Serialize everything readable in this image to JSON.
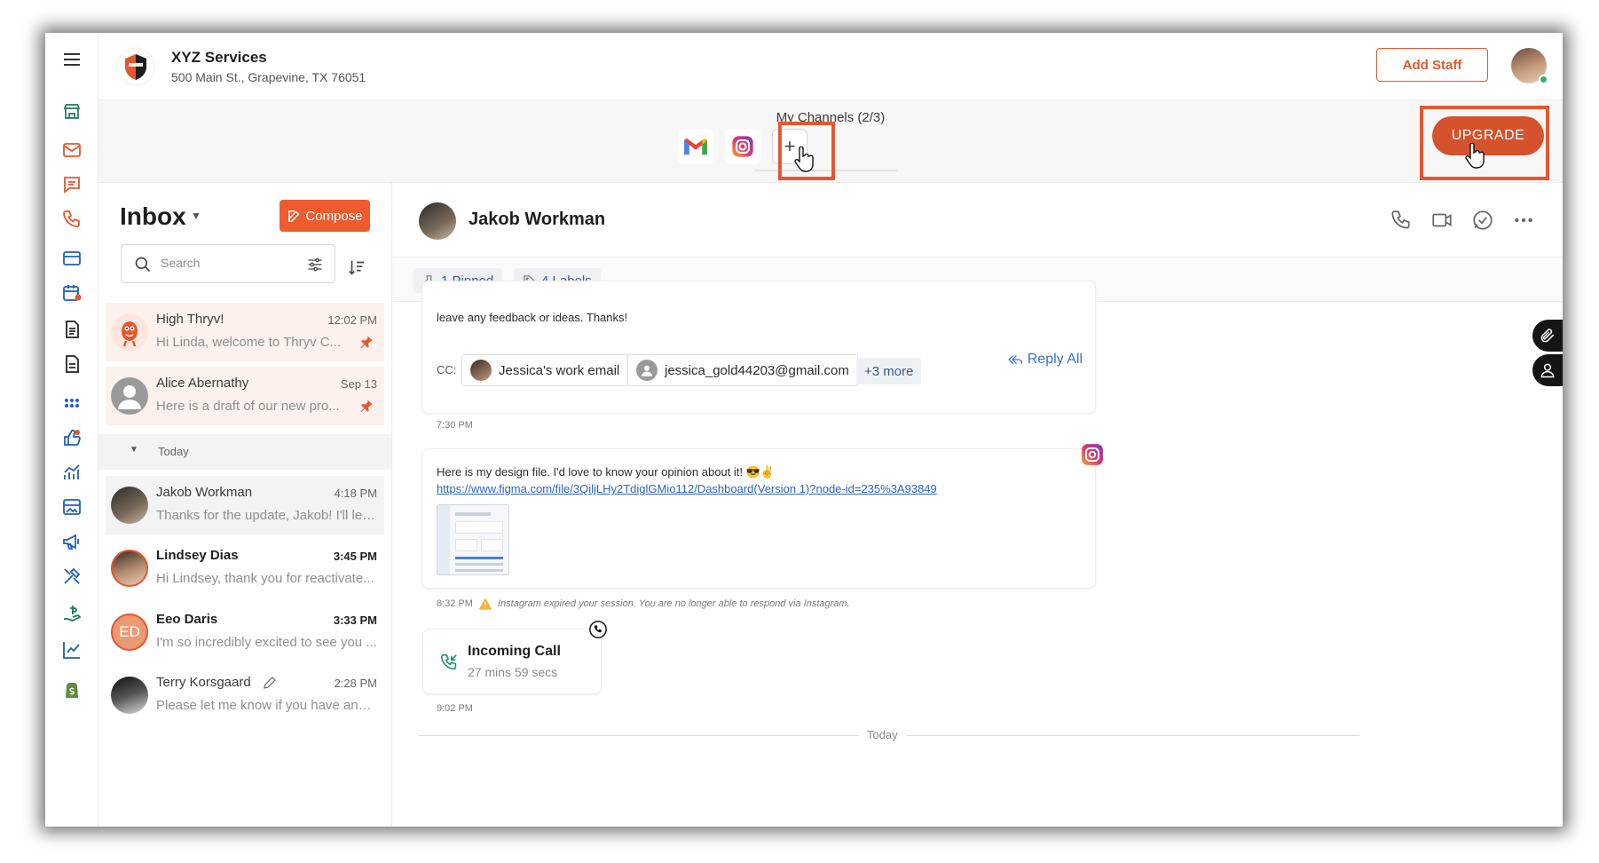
{
  "business": {
    "name": "XYZ Services",
    "address": "500 Main St., Grapevine, TX 76051"
  },
  "header": {
    "add_staff_label": "Add Staff"
  },
  "channels": {
    "title": "My Channels (2/3)",
    "items": [
      "gmail-icon",
      "instagram-icon"
    ],
    "add_label": "+",
    "upgrade_label": "UPGRADE"
  },
  "rail": {
    "icons": [
      "hamburger-menu-icon",
      "storefront-icon",
      "mail-icon",
      "chat-icon",
      "phone-icon",
      "credit-card-icon",
      "calendar-icon",
      "document-icon",
      "invoice-icon",
      "apps-grid-icon",
      "thumbs-up-icon",
      "analytics-icon",
      "gallery-icon",
      "megaphone-icon",
      "tools-icon",
      "payments-icon",
      "trend-chart-icon",
      "shopify-icon"
    ]
  },
  "inbox": {
    "title": "Inbox",
    "compose_label": "Compose",
    "search_placeholder": "Search",
    "today_label": "Today",
    "conversations": [
      {
        "name": "High Thryv!",
        "time": "12:02 PM",
        "preview": "Hi Linda, welcome to Thryv C...",
        "pinned": true,
        "unread": false
      },
      {
        "name": "Alice Abernathy",
        "time": "Sep 13",
        "preview": "Here is a draft of our new pro...",
        "pinned": true,
        "unread": false
      },
      {
        "name": "Jakob Workman",
        "time": "4:18 PM",
        "preview": "Thanks for the update, Jakob! I'll let ...",
        "pinned": false,
        "unread": false
      },
      {
        "name": "Lindsey Dias",
        "time": "3:45 PM",
        "preview": "Hi Lindsey, thank you for reactivate...",
        "pinned": false,
        "unread": true
      },
      {
        "name": "Eeo Daris",
        "initials": "ED",
        "time": "3:33 PM",
        "preview": "I'm so incredibly excited to see you ...",
        "pinned": false,
        "unread": true
      },
      {
        "name": "Terry Korsgaard",
        "time": "2:28 PM",
        "preview": "Please let me know if you have any ...",
        "pinned": false,
        "unread": false
      }
    ]
  },
  "conversation": {
    "contact_name": "Jakob Workman",
    "pinned_label": "1 Pinned",
    "labels_label": "4 Labels",
    "email": {
      "text_tail": "leave any feedback or ideas. Thanks!",
      "cc_label": "CC:",
      "cc": [
        "Jessica's work email",
        "jessica_gold44203@gmail.com"
      ],
      "more_label": "+3 more",
      "reply_all_label": "Reply All",
      "time": "7:30 PM"
    },
    "instagram_message": {
      "text": "Here is my design file. I'd love to know your opinion about it! 😎✌",
      "link": "https://www.figma.com/file/3QiljLHy2TdiglGMio112/Dashboard(Version 1)?node-id=235%3A93849",
      "time": "8:32 PM",
      "warning": "Instagram expired your session. You are no longer able to respond via Instagram."
    },
    "call": {
      "title": "Incoming Call",
      "duration": "27 mins 59 secs",
      "time": "9:02 PM"
    },
    "divider_label": "Today"
  },
  "colors": {
    "accent": "#e5572f",
    "link": "#2a63c9",
    "chip_text": "#3c5a86"
  }
}
